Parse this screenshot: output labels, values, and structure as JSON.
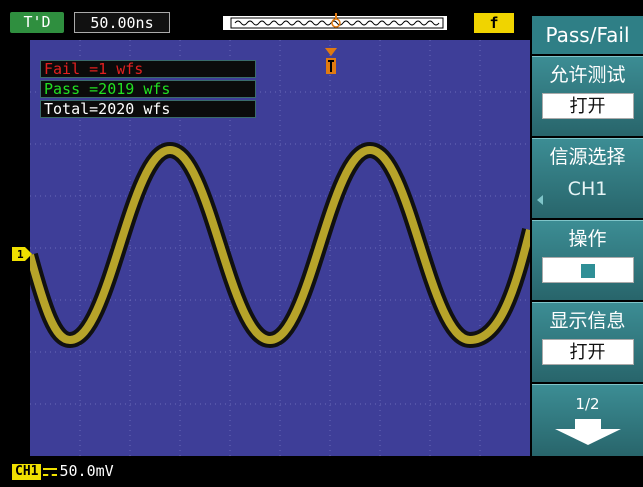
{
  "status": {
    "trigger_mode": "T'D",
    "timebase": "50.00ns",
    "trigger_slope": "f"
  },
  "measurements": {
    "fail": "Fail =1 wfs",
    "pass": "Pass =2019 wfs",
    "total": "Total=2020 wfs"
  },
  "channel": {
    "marker": "1",
    "tag": "CH1",
    "scale": "50.0mV"
  },
  "menu": {
    "title": "Pass/Fail",
    "items": [
      {
        "label": "允许测试",
        "value": "打开"
      },
      {
        "label": "信源选择",
        "value": "CH1"
      },
      {
        "label": "操作",
        "value": ""
      },
      {
        "label": "显示信息",
        "value": "打开"
      }
    ],
    "page": "1/2"
  },
  "colors": {
    "screen": "#3e3e98",
    "trace": "#b7a42a",
    "menu": "#2f7f86",
    "fail": "#e22020",
    "pass": "#22e022"
  },
  "icons": [
    "trigger-position-icon",
    "stop-icon",
    "page-down-arrow-icon"
  ]
}
